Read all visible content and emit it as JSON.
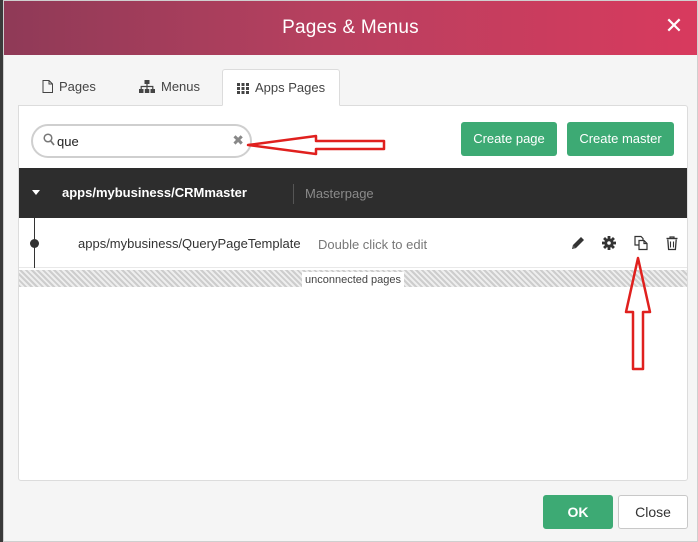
{
  "dialog": {
    "title": "Pages & Menus",
    "close_glyph": "✕"
  },
  "tabs": [
    {
      "label": "Pages",
      "icon": "page-icon"
    },
    {
      "label": "Menus",
      "icon": "sitemap-icon"
    },
    {
      "label": "Apps Pages",
      "icon": "grid-icon",
      "active": true
    }
  ],
  "search": {
    "value": "que",
    "clear_glyph": "✖"
  },
  "buttons": {
    "create_page": "Create page",
    "create_master": "Create master",
    "ok": "OK",
    "close": "Close"
  },
  "master": {
    "path": "apps/mybusiness/CRMmaster",
    "kind": "Masterpage"
  },
  "page": {
    "path": "apps/mybusiness/QueryPageTemplate",
    "hint": "Double click to edit",
    "actions": [
      "pencil-icon",
      "gear-icon",
      "copy-icon",
      "trash-icon"
    ]
  },
  "unconnected_label": "unconnected pages",
  "colors": {
    "accent_green": "#3daa74",
    "title_gradient_start": "#8f3a57",
    "title_gradient_end": "#d83a5e",
    "annotation_red": "#e0201e"
  }
}
